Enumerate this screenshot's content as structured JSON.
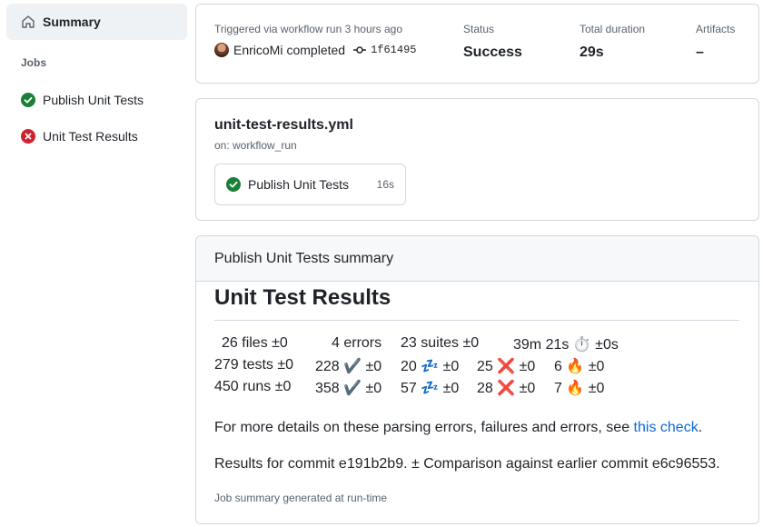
{
  "sidebar": {
    "summary_label": "Summary",
    "jobs_heading": "Jobs",
    "jobs": [
      {
        "label": "Publish Unit Tests",
        "status": "success"
      },
      {
        "label": "Unit Test Results",
        "status": "failure"
      }
    ]
  },
  "run_info": {
    "trigger_text": "Triggered via workflow run 3 hours ago",
    "actor": "EnricoMi",
    "action": "completed",
    "commit": "1f61495",
    "status_label": "Status",
    "status_value": "Success",
    "duration_label": "Total duration",
    "duration_value": "29s",
    "artifacts_label": "Artifacts",
    "artifacts_value": "–"
  },
  "workflow": {
    "file": "unit-test-results.yml",
    "on": "on: workflow_run",
    "job": {
      "name": "Publish Unit Tests",
      "duration": "16s",
      "status": "success"
    }
  },
  "summary": {
    "header": "Publish Unit Tests summary",
    "title": "Unit Test Results",
    "rows": [
      [
        "26 files  ±0",
        "4 errors",
        "23 suites  ±0",
        "39m 21s ⏱️ ±0s"
      ],
      [
        "279 tests ±0",
        "228 ✔️ ±0",
        "20 💤 ±0",
        "25 ❌ ±0",
        "6 🔥 ±0"
      ],
      [
        "450 runs  ±0",
        "358 ✔️ ±0",
        "57 💤 ±0",
        "28 ❌ ±0",
        "7 🔥 ±0"
      ]
    ],
    "details_prefix": "For more details on these parsing errors, failures and errors, see ",
    "details_link": "this check",
    "details_suffix": ".",
    "commit_line": "Results for commit e191b2b9.   ± Comparison against earlier commit e6c96553.",
    "footnote": "Job summary generated at run-time"
  },
  "colors": {
    "success": "#1a7f37",
    "failure": "#cf222e",
    "link": "#0969da",
    "muted": "#59636e",
    "border": "#d1d9e0"
  }
}
